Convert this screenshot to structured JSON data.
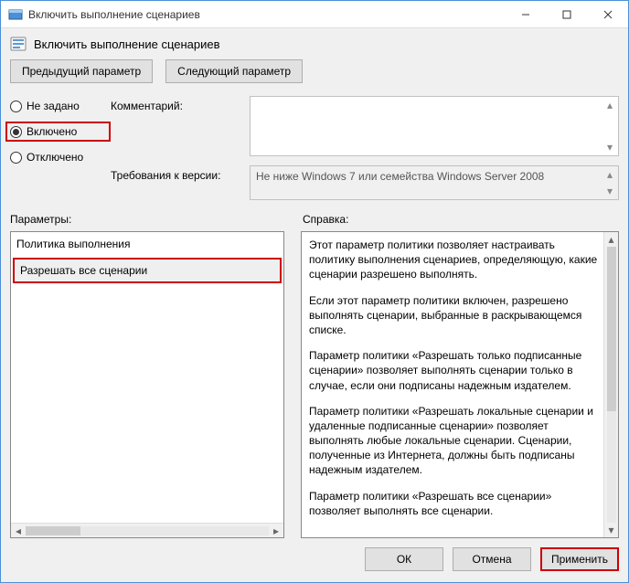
{
  "window": {
    "title": "Включить выполнение сценариев"
  },
  "header": {
    "title": "Включить выполнение сценариев"
  },
  "nav": {
    "prev": "Предыдущий параметр",
    "next": "Следующий параметр"
  },
  "state": {
    "not_configured": "Не задано",
    "enabled": "Включено",
    "disabled": "Отключено",
    "selected": "enabled"
  },
  "fields": {
    "comment_label": "Комментарий:",
    "comment_value": "",
    "requirements_label": "Требования к версии:",
    "requirements_value": "Не ниже Windows 7 или семейства Windows Server 2008"
  },
  "sections": {
    "options_label": "Параметры:",
    "help_label": "Справка:"
  },
  "options": {
    "policy_title": "Политика выполнения",
    "policy_value": "Разрешать все сценарии"
  },
  "help": {
    "p1": "Этот параметр политики позволяет настраивать политику выполнения сценариев, определяющую, какие сценарии разрешено выполнять.",
    "p2": "Если этот параметр политики включен, разрешено выполнять сценарии, выбранные в раскрывающемся списке.",
    "p3": "Параметр политики «Разрешать только подписанные сценарии» позволяет выполнять сценарии только в случае, если они подписаны надежным издателем.",
    "p4": "Параметр политики «Разрешать локальные сценарии и удаленные подписанные сценарии» позволяет выполнять любые локальные сценарии. Сценарии, полученные из Интернета, должны быть подписаны надежным издателем.",
    "p5": "Параметр политики «Разрешать все сценарии» позволяет выполнять все сценарии."
  },
  "buttons": {
    "ok": "ОК",
    "cancel": "Отмена",
    "apply": "Применить"
  }
}
